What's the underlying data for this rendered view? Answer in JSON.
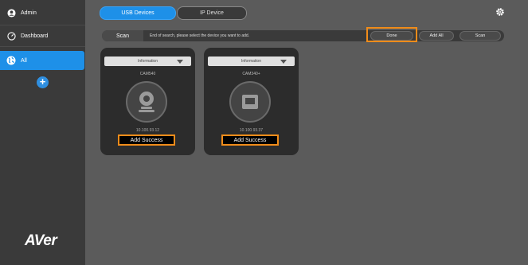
{
  "sidebar": {
    "user": "Admin",
    "dashboard": "Dashboard",
    "group_all": "All",
    "add": "+",
    "logo": "AVer"
  },
  "tabs": {
    "usb": "USB Devices",
    "ip": "IP Device"
  },
  "scanbar": {
    "label": "Scan",
    "message": "End of search, please select the device you want to add.",
    "done": "Done",
    "add_all": "Add All",
    "scan": "Scan"
  },
  "devices": [
    {
      "header": "Information",
      "name": "CAM540",
      "ip": "10.100.93.12",
      "status": "Add Success"
    },
    {
      "header": "Information",
      "name": "CAM340+",
      "ip": "10.100.93.37",
      "status": "Add Success"
    }
  ],
  "colors": {
    "accent": "#1e90e8",
    "highlight": "#f08c1a",
    "sidebar": "#3a3a3a",
    "content": "#5b5b5b"
  }
}
